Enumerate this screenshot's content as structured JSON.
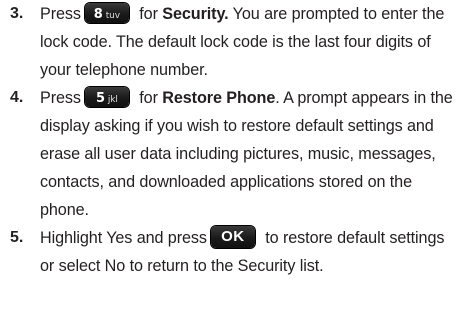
{
  "steps": [
    {
      "number": "3.",
      "pre": "Press",
      "key": {
        "digit": "8",
        "letters": "tuv",
        "icon": "key-8-tuv"
      },
      "post": " for ",
      "bold": "Security.",
      "tail": " You are prompted to enter the",
      "lines": [
        "lock code. The default lock code is the last four digits of",
        "your telephone number."
      ]
    },
    {
      "number": "4.",
      "pre": "Press",
      "key": {
        "digit": "5",
        "letters": "jkl",
        "icon": "key-5-jkl"
      },
      "post": " for ",
      "bold": "Restore Phone",
      "tail": ". A prompt appears in the",
      "lines": [
        "display asking if you wish to restore default settings and",
        "erase all user data including pictures, music, messages,",
        "contacts, and downloaded applications stored on the",
        "phone."
      ]
    },
    {
      "number": "5.",
      "pre": "Highlight Yes and press",
      "key": {
        "label": "OK",
        "icon": "key-ok"
      },
      "tail": " to restore default settings",
      "lines": [
        "or select No to return to the Security list."
      ]
    }
  ]
}
